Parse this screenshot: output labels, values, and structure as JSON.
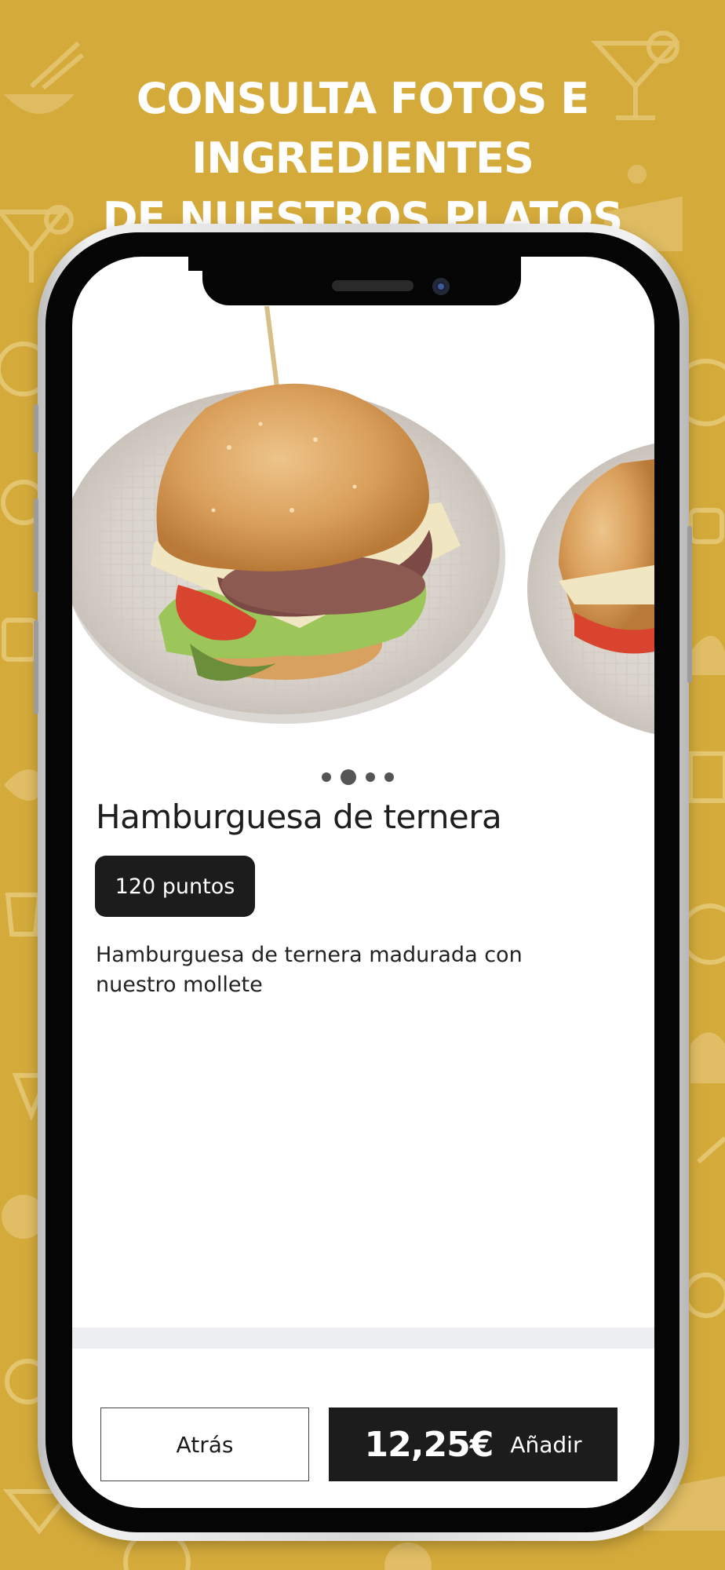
{
  "promo": {
    "headline_line1": "CONSULTA FOTOS E INGREDIENTES",
    "headline_line2": "DE NUESTROS PLATOS"
  },
  "dish": {
    "name": "Hamburguesa de ternera",
    "points": "120 puntos",
    "description": "Hamburguesa de ternera madurada con nuestro mollete",
    "price": "12,25€",
    "image_count": 4,
    "active_image_index": 1
  },
  "actions": {
    "back_label": "Atrás",
    "add_label": "Añadir"
  },
  "colors": {
    "background": "#D4AB3B",
    "button_dark": "#1C1C1C",
    "divider": "#ECEEF1"
  },
  "icons": [
    "burger-photo",
    "carousel-dot"
  ]
}
